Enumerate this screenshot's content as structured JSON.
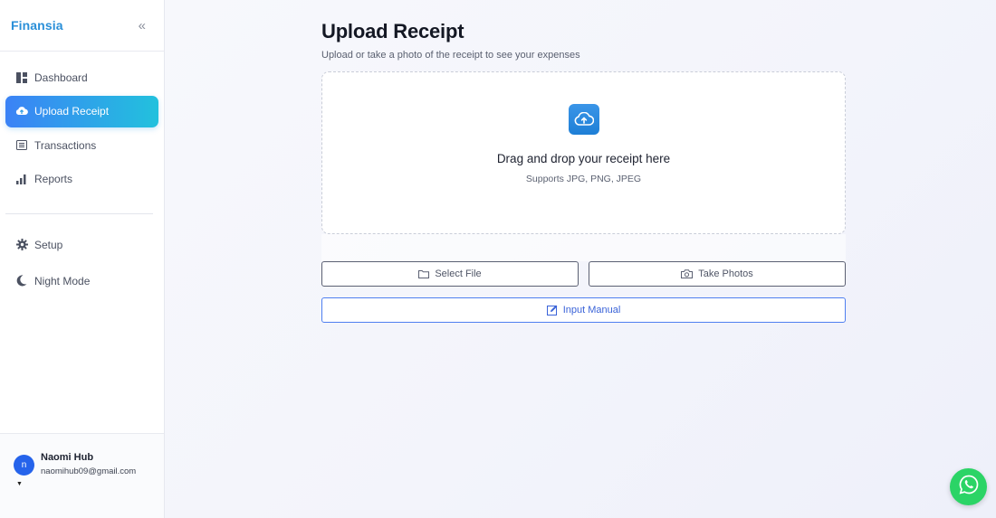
{
  "sidebar": {
    "brand": "Finansia",
    "collapse_icon": "double-chevron-left-icon",
    "items": [
      {
        "label": "Dashboard",
        "icon": "dashboard-icon",
        "active": false
      },
      {
        "label": "Upload Receipt",
        "icon": "cloud-upload-icon",
        "active": true
      },
      {
        "label": "Transactions",
        "icon": "list-icon",
        "active": false
      },
      {
        "label": "Reports",
        "icon": "bar-chart-icon",
        "active": false
      }
    ],
    "secondary": [
      {
        "label": "Setup",
        "icon": "gear-icon"
      },
      {
        "label": "Night Mode",
        "icon": "moon-icon"
      }
    ],
    "user": {
      "initial": "n",
      "name": "Naomi Hub",
      "email": "naomihub09@gmail.com"
    }
  },
  "main": {
    "title": "Upload Receipt",
    "subtitle": "Upload or take a photo of the receipt to see your expenses",
    "dropzone": {
      "icon": "cloud-upload-icon",
      "title": "Drag and drop your receipt here",
      "supported": "Supports JPG, PNG, JPEG"
    },
    "buttons": {
      "select_file": "Select File",
      "take_photos": "Take Photos",
      "input_manual": "Input Manual"
    }
  },
  "colors": {
    "brand": "#2a8fd8",
    "active_gradient_start": "#3b82f6",
    "active_gradient_end": "#22c1dd",
    "whatsapp": "#2bd466"
  },
  "floating": {
    "icon": "whatsapp-icon"
  }
}
